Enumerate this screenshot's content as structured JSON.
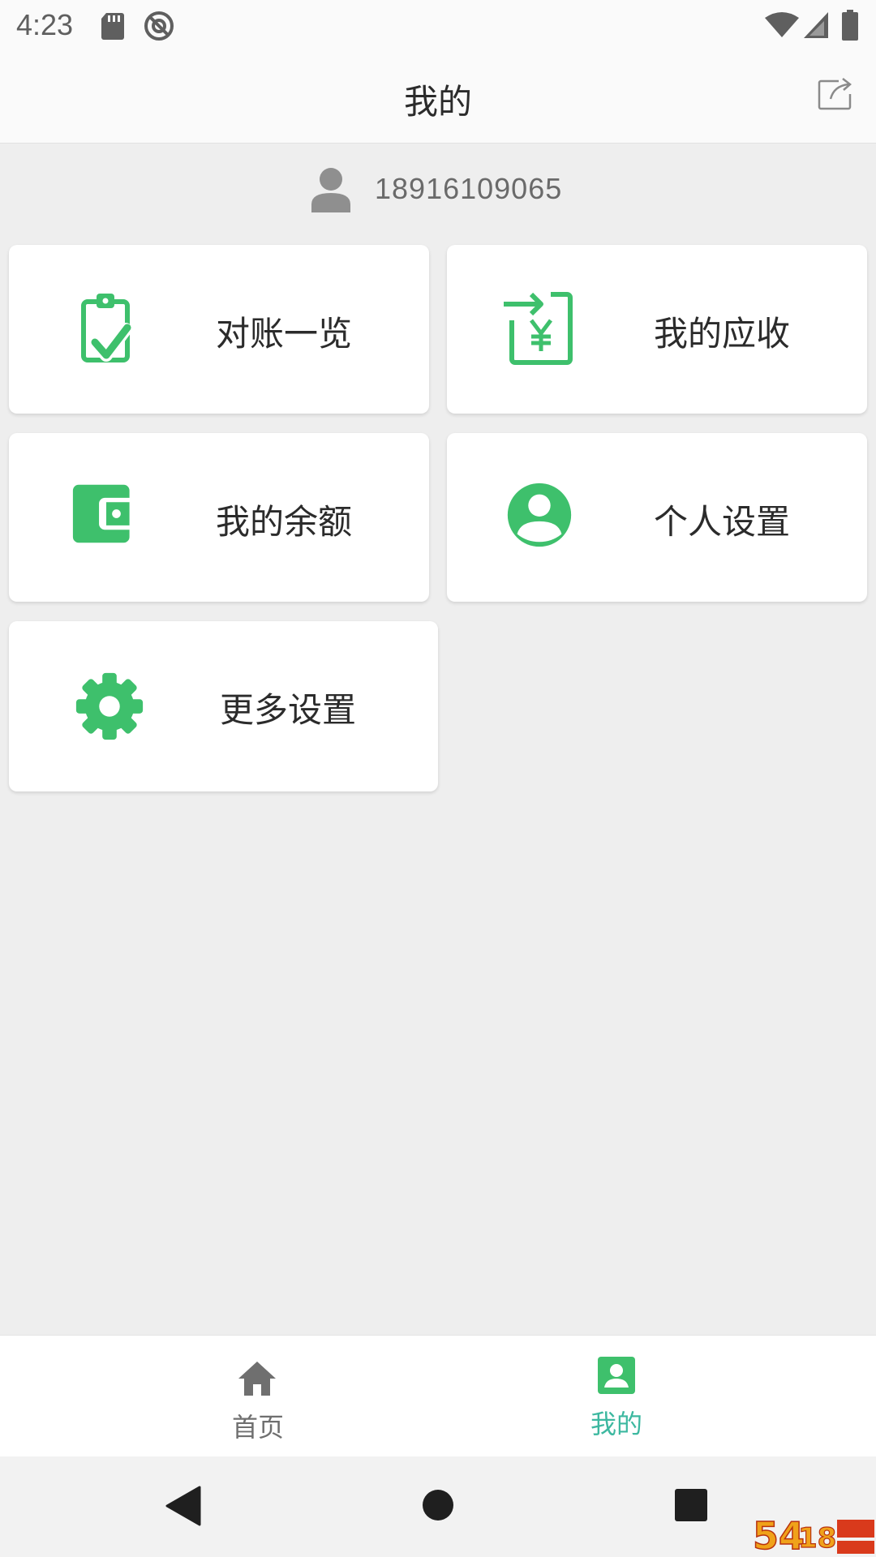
{
  "status_bar": {
    "time": "4:23",
    "icons": [
      "sd-card-icon",
      "no-disturb-icon",
      "wifi-icon",
      "signal-icon",
      "battery-icon"
    ]
  },
  "header": {
    "title": "我的",
    "share_icon": "share-icon"
  },
  "user": {
    "avatar_icon": "user-avatar-icon",
    "phone": "18916109065"
  },
  "menu": [
    {
      "label": "对账一览",
      "icon": "clipboard-check-icon"
    },
    {
      "label": "我的应收",
      "icon": "receivable-yuan-icon"
    },
    {
      "label": "我的余额",
      "icon": "wallet-icon"
    },
    {
      "label": "个人设置",
      "icon": "account-circle-icon"
    },
    {
      "label": "更多设置",
      "icon": "gear-icon"
    }
  ],
  "bottom_nav": {
    "items": [
      {
        "label": "首页",
        "icon": "home-icon",
        "active": false
      },
      {
        "label": "我的",
        "icon": "account-box-icon",
        "active": true
      }
    ]
  },
  "system_nav": [
    "back-icon",
    "home-circle-icon",
    "recents-icon"
  ],
  "colors": {
    "accent": "#3ec06c",
    "active_tab": "#3db8a0",
    "inactive_tab": "#6f6f6f",
    "background": "#eeeeee",
    "card": "#ffffff"
  }
}
